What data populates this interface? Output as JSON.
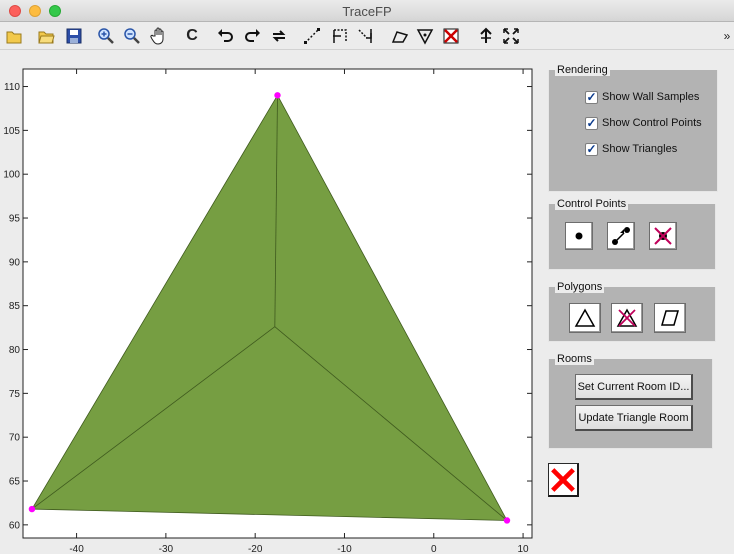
{
  "window": {
    "title": "TraceFP"
  },
  "toolbar": {
    "tools": [
      "new-file-icon",
      "open-folder-icon",
      "save-icon",
      "zoom-in-icon",
      "zoom-out-icon",
      "pan-hand-icon",
      "c-tool-icon",
      "undo-icon",
      "redo-icon",
      "refresh-icon",
      "line-dashed-icon",
      "bracket-select-icon",
      "snap-icon",
      "polygon-draw-icon",
      "triangle-down-icon",
      "delete-red-icon",
      "move-arrow-icon",
      "expand-arrows-icon"
    ],
    "overflow_glyph": "»"
  },
  "chart_data": {
    "type": "scatter",
    "title": "",
    "xlabel": "",
    "ylabel": "",
    "xlim": [
      -46,
      11
    ],
    "ylim": [
      58.5,
      112
    ],
    "x_ticks": [
      -40,
      -30,
      -20,
      -10,
      0,
      10
    ],
    "y_ticks": [
      60,
      65,
      70,
      75,
      80,
      85,
      90,
      95,
      100,
      105,
      110
    ],
    "fill_color": "#769e42",
    "edge_color": "#3f5a1e",
    "point_color": "#ff00ff",
    "control_points": [
      {
        "x": -17.5,
        "y": 109
      },
      {
        "x": -45,
        "y": 61.8
      },
      {
        "x": 8.2,
        "y": 60.5
      }
    ],
    "interior_point": {
      "x": -17.8,
      "y": 82.6
    }
  },
  "rendering": {
    "title": "Rendering",
    "options": [
      {
        "label": "Show Wall Samples",
        "checked": true
      },
      {
        "label": "Show Control Points",
        "checked": true
      },
      {
        "label": "Show Triangles",
        "checked": true
      }
    ]
  },
  "control_points_panel": {
    "title": "Control Points"
  },
  "polygons_panel": {
    "title": "Polygons"
  },
  "rooms": {
    "title": "Rooms",
    "set_room_label": "Set Current Room ID...",
    "update_label": "Update Triangle Room"
  },
  "checkmark": "✓",
  "colors": {
    "window_bg": "#ececec",
    "panel_bg": "#b3b3b3"
  }
}
